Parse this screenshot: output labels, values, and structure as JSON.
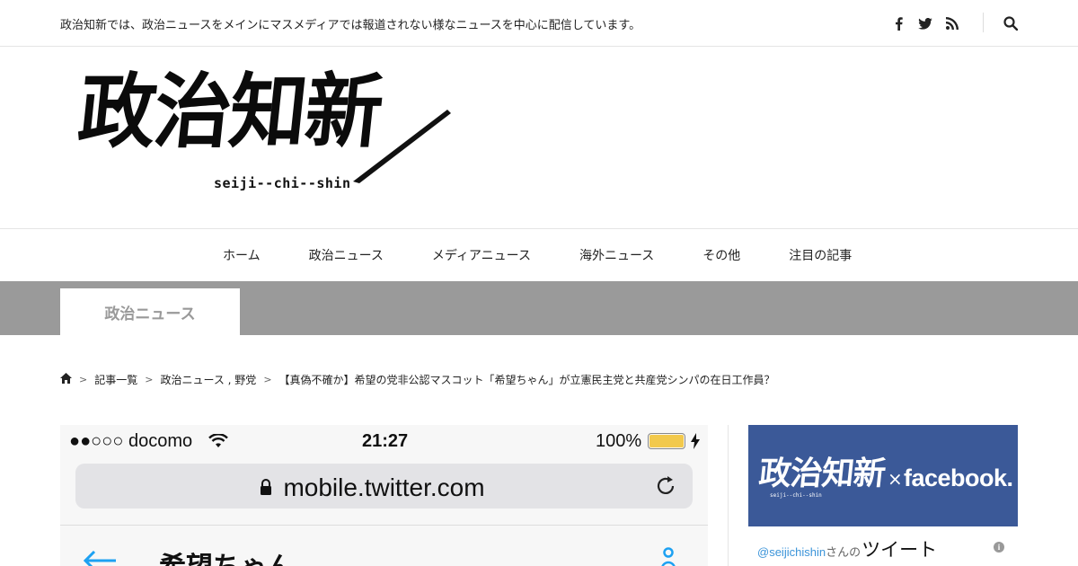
{
  "header": {
    "tagline": "政治知新では、政治ニュースをメインにマスメディアでは報道されない様なニュースを中心に配信しています。",
    "social_icons": [
      "facebook-icon",
      "twitter-icon",
      "rss-icon"
    ],
    "search_icon": "search-icon"
  },
  "logo": {
    "kanji": "政治知新",
    "romaji": "seiji--chi--shin"
  },
  "nav": {
    "items": [
      "ホーム",
      "政治ニュース",
      "メディアニュース",
      "海外ニュース",
      "その他",
      "注目の記事"
    ]
  },
  "category": {
    "title": "政治ニュース"
  },
  "breadcrumb": {
    "home_icon": "home-icon",
    "items": [
      "記事一覧",
      "政治ニュース , 野党",
      "【真偽不確か】希望の党非公認マスコット「希望ちゃん」が立憲民主党と共産党シンパの在日工作員？"
    ]
  },
  "article_image": {
    "carrier": "●●○○○ docomo",
    "time": "21:27",
    "battery": "100%",
    "url": "mobile.twitter.com",
    "profile_name": "希望ちゃん"
  },
  "sidebar": {
    "fb_banner_kanji": "政治知新",
    "fb_banner_small": "seiji--chi--shin",
    "fb_banner_x": "×",
    "fb_banner_word": "facebook.",
    "tweet_handle": "@seijichishin",
    "tweet_suffix": "さんの",
    "tweet_title": "ツイート",
    "info_glyph": "i"
  },
  "colors": {
    "facebook_blue": "#3b5998",
    "band_gray": "#9a9a9a",
    "link_blue": "#3b94d9",
    "battery_yellow": "#f2c94c"
  }
}
